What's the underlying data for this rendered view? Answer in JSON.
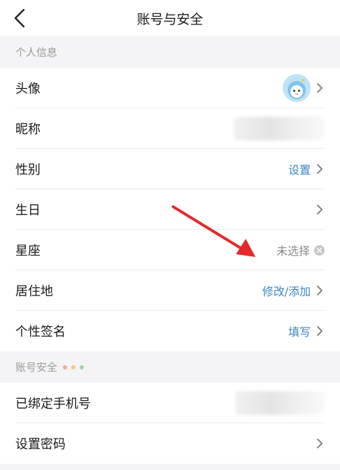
{
  "header": {
    "title": "账号与安全",
    "back_icon": "chevron-left-icon"
  },
  "sections": [
    {
      "id": "personal",
      "label": "个人信息"
    },
    {
      "id": "security",
      "label": "账号安全",
      "dot_colors": [
        "#f3a4a4",
        "#f5c97a",
        "#9fd3a7"
      ]
    }
  ],
  "personal_rows": [
    {
      "label": "头像",
      "value": "",
      "value_type": "avatar"
    },
    {
      "label": "昵称",
      "value": "",
      "value_type": "blurred"
    },
    {
      "label": "性别",
      "value": "设置",
      "value_type": "link"
    },
    {
      "label": "生日",
      "value": "",
      "value_type": "none"
    },
    {
      "label": "星座",
      "value": "未选择",
      "value_type": "clearable"
    },
    {
      "label": "居住地",
      "value": "修改/添加",
      "value_type": "link"
    },
    {
      "label": "个性签名",
      "value": "填写",
      "value_type": "link"
    }
  ],
  "security_rows": [
    {
      "label": "已绑定手机号",
      "value": "",
      "value_type": "blurred"
    },
    {
      "label": "设置密码",
      "value": "",
      "value_type": "none"
    }
  ],
  "annotation": {
    "color": "#e6282b"
  },
  "colors": {
    "link": "#3a87c7",
    "muted": "#8a8a8a",
    "background": "#f4f4f6"
  }
}
